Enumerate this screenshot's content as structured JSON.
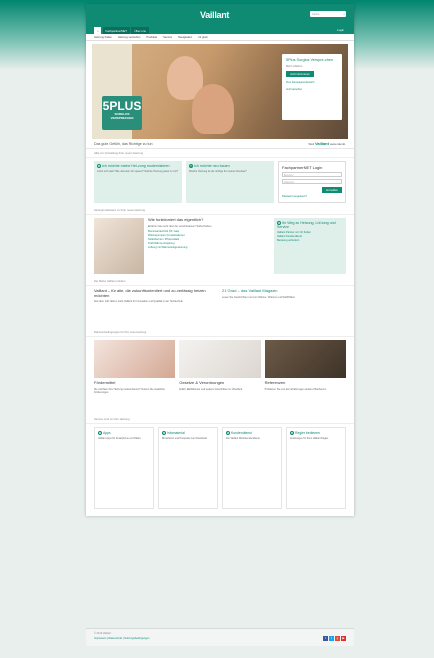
{
  "header": {
    "brand": "Vaillant",
    "search_placeholder": "Suche",
    "tabs": [
      "Fachpartner/NET",
      "Über uns"
    ],
    "login": "Login"
  },
  "nav": [
    "Heizung finden",
    "Heizung verstehen",
    "Produkte",
    "Service",
    "Neuigkeiten",
    "21 grad"
  ],
  "hero": {
    "badge_big": "5PLUS",
    "badge_small1": "SORGLOS",
    "badge_small2": "VERSPRECHEN",
    "promo_title": "5Plus Sorglos Verspre-chen",
    "promo_text": "Mehr erfahren",
    "promo_button": "Jetzt informieren",
    "promo_link1": "Zum Kampagnenbereich",
    "promo_link2": "Jetzt ansehen"
  },
  "tagline": {
    "left": "Das gute Gefühl, das Richtige zu tun",
    "right_prefix": "Weil",
    "right_brand": "Vaillant",
    "right_suffix": "weiterdenkt."
  },
  "section1": {
    "title": "Hilfe zur Vorstellung Ihrer neuen Heizung",
    "box1_title": "Ich möchte meine Hei-zung modernisieren",
    "box1_text": "Lohnt sich das? Wie viel kann ich sparen? Welche Heizung passt zu mir?",
    "box2_title": "Ich möchte neu bauen",
    "box2_text": "Welche Heizung ist die richtige für meinen Neubau?",
    "login_title": "FachpartnerNET Login",
    "login_user": "Benutzer",
    "login_pass": "Passwort",
    "login_button": "Anmelden",
    "login_link": "Passwort vergessen?"
  },
  "section2": {
    "title": "Hintergrundwissen zu Ihrer neuen Heizung",
    "mid_title": "Wie funktioniert das eigentlich?",
    "mid_text": "Erfahren Sie mehr über die verschiedenen Heiztechniken.",
    "mid_list": [
      "Brennwerttechnik (Öl, Gas)",
      "Wärmepumpen (Umweltwärme)",
      "Solarthermie / Photovoltaik",
      "Kraft-Wärme-Kopplung",
      "Lüftung mit Wärmerückgewinnung"
    ],
    "right_title": "Ihr Weg zu Heizung, Lüf-tung und Service",
    "right_list": [
      "Vaillant Partner vor Ort finden",
      "Vaillant Kundendienst",
      "Beratung anfordern"
    ]
  },
  "section3": {
    "title": "Die Marke Vaillant erleben",
    "left_title": "Vaillant – für alle, die zukunftsorientiert und zu-verlässig heizen möchten",
    "left_text": "Seit über 140 Jahren steht Vaillant für Innovation und Qualität in der Heiztechnik.",
    "right_title": "21 Grad – das Vaillant Magazin",
    "right_text": "Lesen Sie Geschichten rund um Wärme, Wohnen und Wohlfühlen."
  },
  "section4": {
    "title": "Rahmenbedingungen für Ihre neue Heizung",
    "cards": [
      {
        "title": "Fördermittel",
        "text": "Sie möchten Ihre Heizung modernisieren? Nutzen Sie staatliche Förderungen."
      },
      {
        "title": "Gesetze & Verordnungen",
        "text": "EnEV, EEWärmeG und weitere Vorschriften im Überblick."
      },
      {
        "title": "Referenzen",
        "text": "Profitieren Sie von den Erfahrungen anderer Bauherren."
      }
    ]
  },
  "section5": {
    "title": "Service rund um Ihre Heizung",
    "items": [
      {
        "title": "Apps",
        "text": "Vaillant Apps für Smartphone und Tablet."
      },
      {
        "title": "Infomaterial",
        "text": "Broschüren und Prospekte zum Download."
      },
      {
        "title": "Kundendienst",
        "text": "Der Vaillant Werkskundendienst."
      },
      {
        "title": "Regler bedienen",
        "text": "Anleitungen für Ihren Vaillant Regler."
      }
    ]
  },
  "footer": {
    "copyright": "© 2013 Vaillant",
    "links": "Impressum | Datenschutz | Nutzungsbedingungen"
  }
}
